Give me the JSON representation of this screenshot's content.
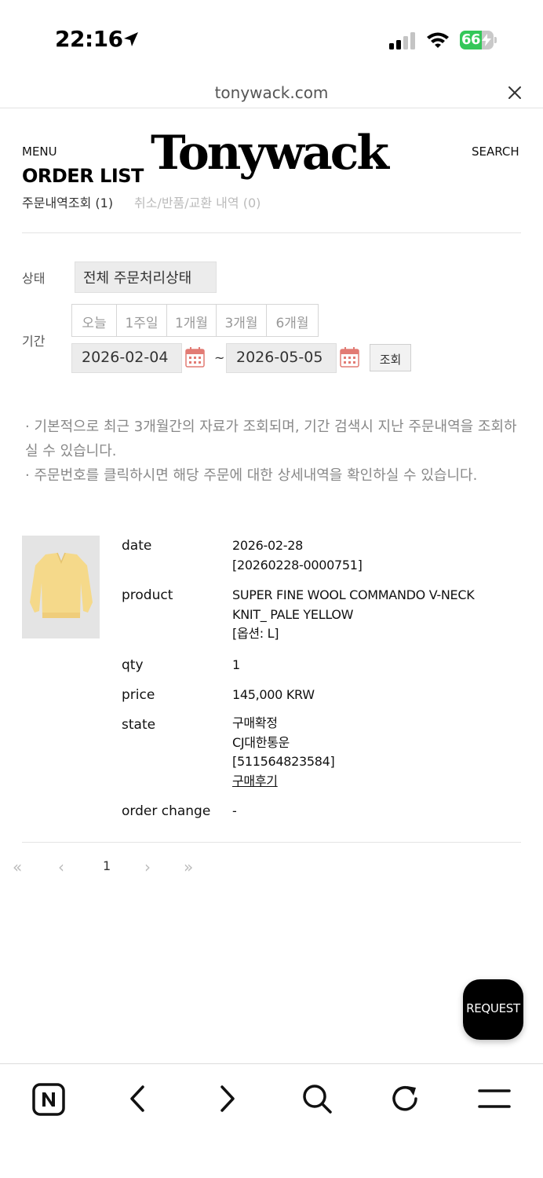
{
  "status_bar": {
    "time": "22:16",
    "battery": "66",
    "battery_level": 0.66,
    "icons": [
      "location-arrow-icon",
      "cellular-signal-icon",
      "wifi-icon",
      "battery-charging-icon"
    ]
  },
  "browser": {
    "url": "tonywack.com",
    "close_icon": "close-icon"
  },
  "header": {
    "menu": "MENU",
    "logo": "Tonywack",
    "search": "SEARCH"
  },
  "page": {
    "title": "ORDER LIST",
    "tabs": [
      {
        "label": "주문내역조회 (1)",
        "active": true
      },
      {
        "label": "취소/반품/교환 내역 (0)",
        "active": false
      }
    ]
  },
  "filters": {
    "status_label": "상태",
    "status_value": "전체 주문처리상태",
    "period_label": "기간",
    "period_buttons": [
      "오늘",
      "1주일",
      "1개월",
      "3개월",
      "6개월"
    ],
    "date_from": "2026-02-04",
    "separator": "~",
    "date_to": "2026-05-05",
    "search_button": "조회",
    "calendar_icon": "calendar-icon"
  },
  "notes": [
    "· 기본적으로 최근 3개월간의 자료가 조회되며, 기간 검색시 지난 주문내역을 조회하실 수 있습니다.",
    "· 주문번호를 클릭하시면 해당 주문에 대한 상세내역을 확인하실 수 있습니다."
  ],
  "order": {
    "labels": {
      "date": "date",
      "product": "product",
      "qty": "qty",
      "price": "price",
      "state": "state",
      "order_change": "order change"
    },
    "date": "2026-02-28",
    "order_no": "[20260228-0000751]",
    "product_line1": "SUPER FINE WOOL COMMANDO V-NECK",
    "product_line2": "KNIT_ PALE YELLOW",
    "product_option": "[옵션: L]",
    "qty": "1",
    "price": "145,000 KRW",
    "state": "구매확정",
    "courier": "CJ대한통운",
    "tracking": "[511564823584]",
    "review": "구매후기",
    "order_change": "-",
    "thumb_colors": {
      "background": "#e4e4e4",
      "sweater": "#f5d98a"
    }
  },
  "pagination": {
    "first": "«",
    "prev": "‹",
    "current": "1",
    "next": "›",
    "last": "»"
  },
  "floating": {
    "request": "REQUEST"
  },
  "toolbar": {
    "icons": [
      "naver-n-icon",
      "back-arrow-icon",
      "forward-arrow-icon",
      "search-icon",
      "reload-icon",
      "hamburger-menu-icon"
    ]
  }
}
